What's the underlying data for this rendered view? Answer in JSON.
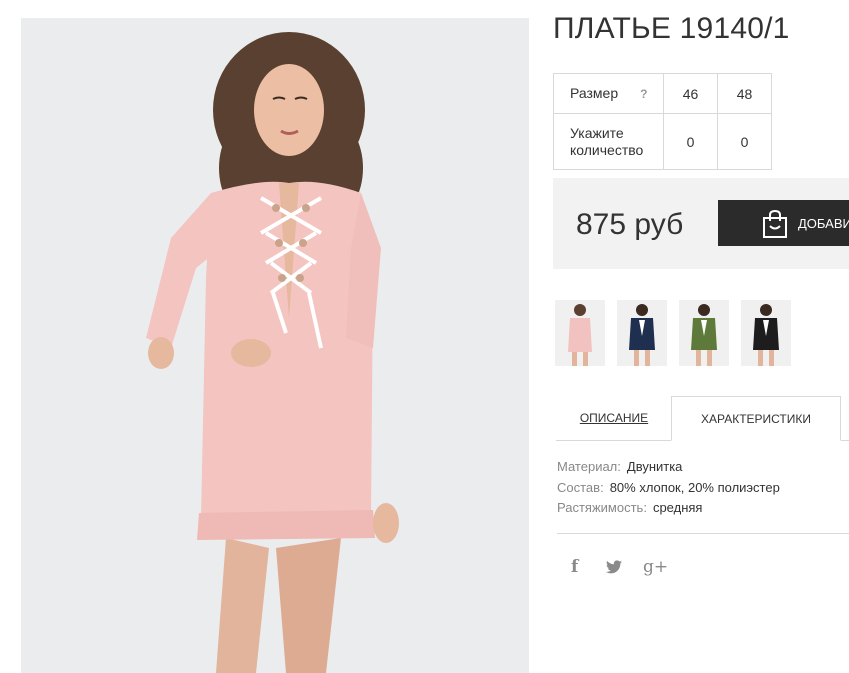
{
  "product": {
    "title": "ПЛАТЬЕ 19140/1",
    "image_alt": "main product photo"
  },
  "size_table": {
    "size_label": "Размер",
    "help_icon": "?",
    "sizes": [
      "46",
      "48"
    ],
    "qty_label_line1": "Укажите",
    "qty_label_line2": "количество",
    "quantities": [
      "0",
      "0"
    ]
  },
  "purchase": {
    "price": "875 руб",
    "buy_button": "ДОБАВИ",
    "buy_icon": "shopping-bag-icon"
  },
  "thumbnails": [
    {
      "name": "pink",
      "color": "#f2c2c0"
    },
    {
      "name": "navy",
      "color": "#1f2f4f"
    },
    {
      "name": "olive",
      "color": "#5d7a3a"
    },
    {
      "name": "black",
      "color": "#1d1d1d"
    }
  ],
  "tabs": {
    "description": "ОПИСАНИЕ",
    "characteristics": "ХАРАКТЕРИСТИКИ",
    "active": "characteristics"
  },
  "specs": [
    {
      "key": "Материал:",
      "value": "Двунитка"
    },
    {
      "key": "Состав:",
      "value": "80% хлопок, 20% полиэстер"
    },
    {
      "key": "Растяжимость:",
      "value": "средняя"
    }
  ],
  "social": {
    "facebook": "f",
    "twitter": "twitter-icon",
    "google_plus": "g+"
  },
  "colors": {
    "dress_pink": "#f4c4c0",
    "button_dark": "#2b2b2b",
    "price_bg": "#f2f2f2",
    "border": "#d9d9d9"
  }
}
